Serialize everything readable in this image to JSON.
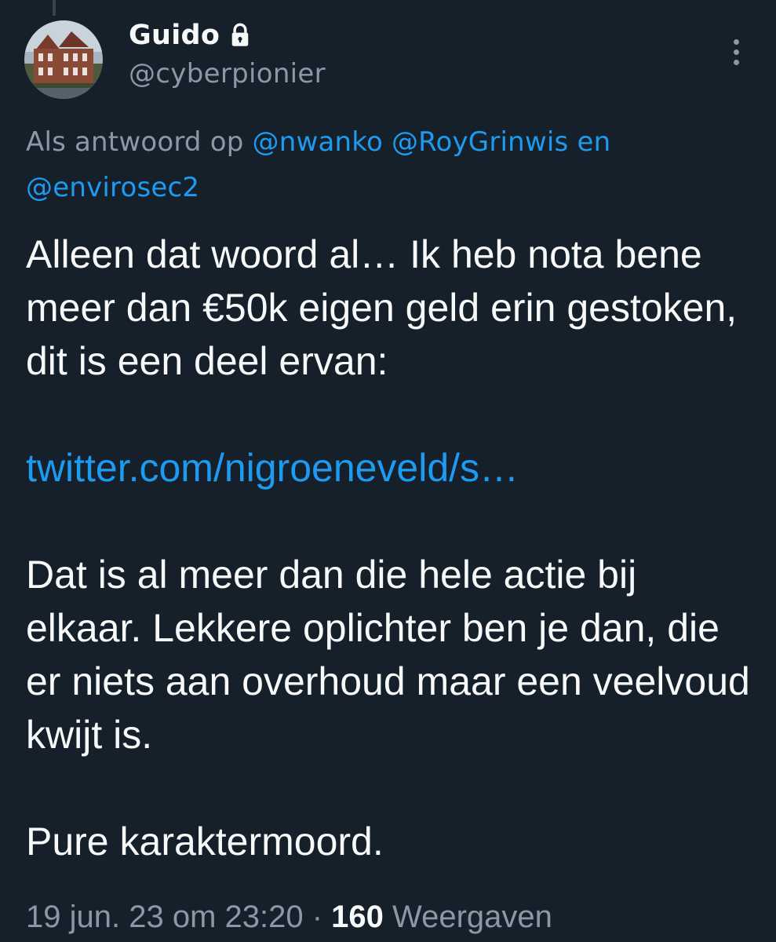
{
  "author": {
    "display_name": "Guido",
    "handle": "@cyberpionier",
    "protected_icon": "lock-icon",
    "avatar": "building-photo-avatar"
  },
  "more_icon": "more-vertical-icon",
  "reply_context": {
    "prefix": "Als antwoord op",
    "mention_1": "@nwanko",
    "mention_2": "@RoyGrinwis",
    "connector": "en",
    "mention_3": "@envirosec2"
  },
  "tweet": {
    "paragraph_1": "Alleen dat woord al… Ik heb nota bene meer dan €50k eigen geld erin gestoken, dit is een deel ervan:",
    "link": "twitter.com/nigroeneveld/s…",
    "paragraph_2": "Dat is al meer dan die hele actie bij elkaar. Lekkere oplichter ben je dan, die er niets aan overhoud maar een veelvoud kwijt is.",
    "paragraph_3": "Pure karaktermoord."
  },
  "meta": {
    "timestamp": "19 jun. 23 om 23:20",
    "separator": "·",
    "views_count": "160",
    "views_label": "Weergaven"
  },
  "colors": {
    "background": "#15202b",
    "text": "#f7f9f9",
    "secondary": "#8b98a5",
    "accent": "#1d9bf0"
  }
}
